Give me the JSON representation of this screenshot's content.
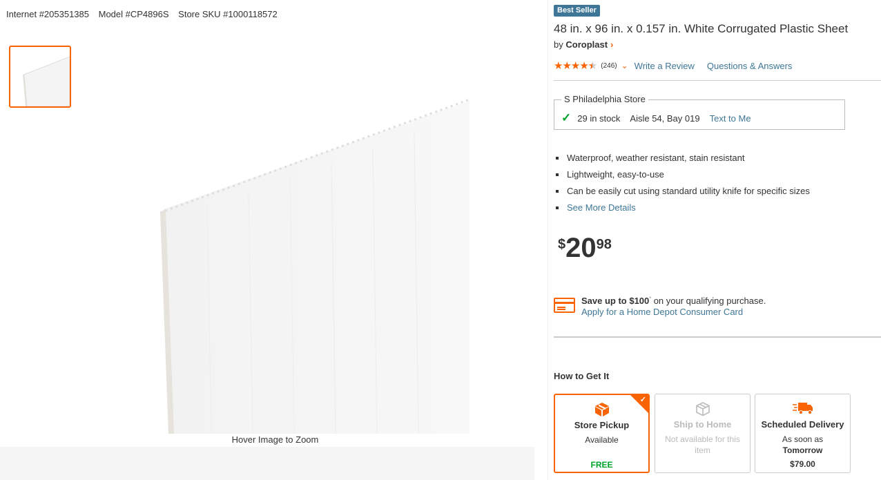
{
  "ids": {
    "internet": "Internet #205351385",
    "model": "Model #CP4896S",
    "sku": "Store SKU #1000118572"
  },
  "media": {
    "hover_text": "Hover Image to Zoom"
  },
  "product": {
    "badge": "Best Seller",
    "title": "48 in. x 96 in. x 0.157 in. White Corrugated Plastic Sheet",
    "by": "by",
    "brand": "Coroplast",
    "rating_count": "(246)",
    "rating_value": 4.5,
    "write_review": "Write a Review",
    "qa": "Questions & Answers"
  },
  "store": {
    "name": "S Philadelphia Store",
    "stock": "29 in stock",
    "aisle": "Aisle 54, Bay 019",
    "text_me": "Text to Me"
  },
  "bullets": [
    "Waterproof, weather resistant, stain resistant",
    "Lightweight, easy-to-use",
    "Can be easily cut using standard utility knife for specific sizes"
  ],
  "see_more": "See More Details",
  "price": {
    "currency": "$",
    "dollars": "20",
    "cents": "98"
  },
  "promo": {
    "save_bold": "Save up to $100",
    "save_sup": "°",
    "save_rest": " on your qualifying purchase.",
    "apply": "Apply for a Home Depot Consumer Card"
  },
  "fulfillment": {
    "heading": "How to Get It",
    "options": [
      {
        "title": "Store Pickup",
        "sub": "Available",
        "price": "FREE"
      },
      {
        "title": "Ship to Home",
        "sub": "Not available for this item",
        "price": ""
      },
      {
        "title": "Scheduled Delivery",
        "sub": "As soon as",
        "sub_bold": "Tomorrow",
        "price": "$79.00"
      }
    ]
  },
  "colors": {
    "accent": "#f96302",
    "link": "#3e7697",
    "badge": "#3e7697",
    "success": "#00a32a"
  }
}
